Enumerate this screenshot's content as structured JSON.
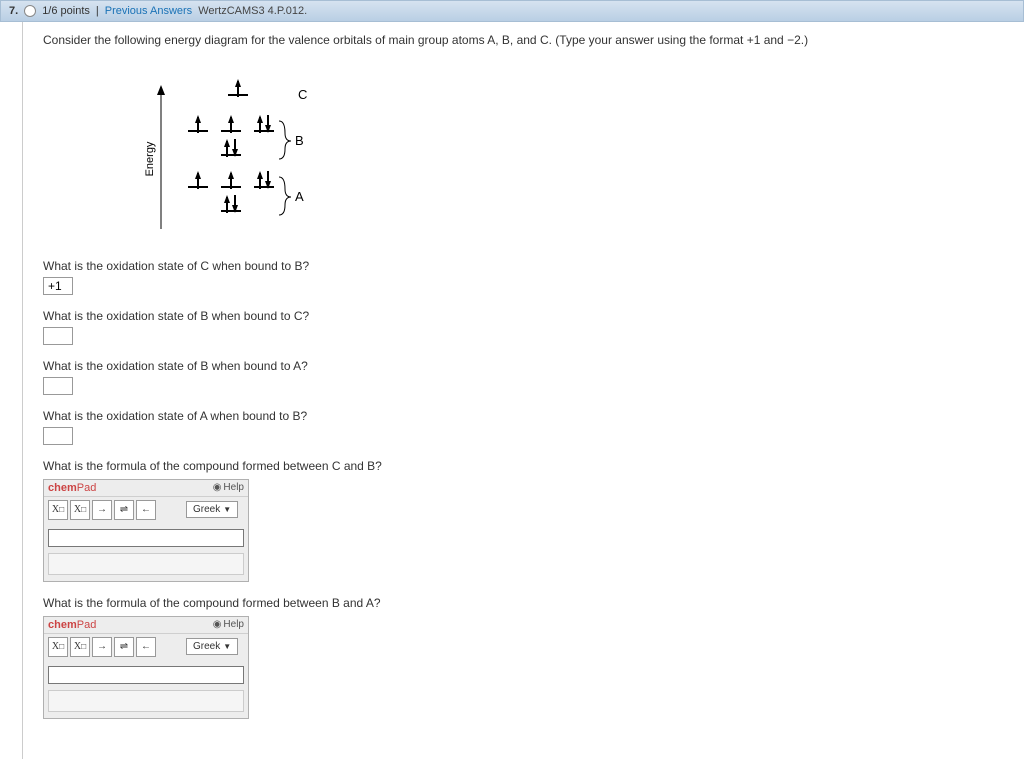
{
  "header": {
    "question_number": "7.",
    "points": "1/6 points",
    "separator": "|",
    "prev_answers": "Previous Answers",
    "source": "WertzCAMS3 4.P.012."
  },
  "prompt": "Consider the following energy diagram for the valence orbitals of main group atoms A, B, and C. (Type your answer using the format +1 and −2.)",
  "diagram": {
    "energy_label": "Energy",
    "atoms": [
      "C",
      "B",
      "A"
    ]
  },
  "questions": [
    {
      "text": "What is the oxidation state of C when bound to B?",
      "value": "+1"
    },
    {
      "text": "What is the oxidation state of B when bound to C?",
      "value": ""
    },
    {
      "text": "What is the oxidation state of B when bound to A?",
      "value": ""
    },
    {
      "text": "What is the oxidation state of A when bound to B?",
      "value": ""
    }
  ],
  "chempad_questions": [
    {
      "text": "What is the formula of the compound formed between C and B?"
    },
    {
      "text": "What is the formula of the compound formed between B and A?"
    }
  ],
  "chempad": {
    "title_prefix": "chem",
    "title_suffix": "Pad",
    "help": "Help",
    "greek": "Greek",
    "tools": {
      "sub": "X□",
      "sup": "X□",
      "right": "→",
      "equil": "⇌",
      "left": "←"
    }
  }
}
